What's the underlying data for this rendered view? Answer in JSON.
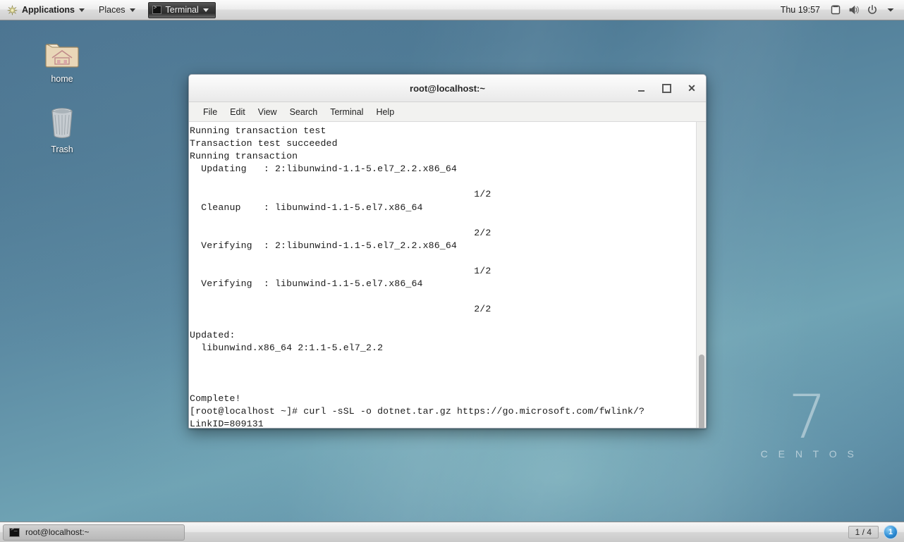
{
  "top_panel": {
    "applications_label": "Applications",
    "places_label": "Places",
    "window_item_label": "Terminal",
    "clock": "Thu 19:57",
    "tray": [
      {
        "name": "display-icon",
        "label": "display"
      },
      {
        "name": "volume-icon",
        "label": "volume"
      },
      {
        "name": "power-icon",
        "label": "power"
      }
    ]
  },
  "desktop_icons": [
    {
      "name": "home",
      "label": "home"
    },
    {
      "name": "trash",
      "label": "Trash"
    }
  ],
  "watermark": {
    "version": "7",
    "name": "C E N T O S"
  },
  "terminal": {
    "title": "root@localhost:~",
    "menu": [
      "File",
      "Edit",
      "View",
      "Search",
      "Terminal",
      "Help"
    ],
    "window_buttons": {
      "minimize": "_",
      "maximize": "□",
      "close": "✕"
    },
    "lines": [
      "Running transaction test",
      "Transaction test succeeded",
      "Running transaction",
      "  Updating   : 2:libunwind-1.1-5.el7_2.2.x86_64",
      "",
      "                                                  1/2",
      "  Cleanup    : libunwind-1.1-5.el7.x86_64",
      "",
      "                                                  2/2",
      "  Verifying  : 2:libunwind-1.1-5.el7_2.2.x86_64",
      "",
      "                                                  1/2",
      "  Verifying  : libunwind-1.1-5.el7.x86_64",
      "",
      "                                                  2/2",
      "",
      "Updated:",
      "  libunwind.x86_64 2:1.1-5.el7_2.2",
      "",
      "",
      "",
      "Complete!",
      "[root@localhost ~]# curl -sSL -o dotnet.tar.gz https://go.microsoft.com/fwlink/?",
      "LinkID=809131"
    ]
  },
  "bottom_panel": {
    "task_label": "root@localhost:~",
    "workspace": "1 / 4",
    "notification_count": "1"
  },
  "colors": {
    "desktop_base": "#5d8ca4",
    "panel_bg": "#ededed",
    "terminal_bg": "#ffffff",
    "terminal_fg": "#1b1b1b",
    "accent_blue": "#2f8ed6"
  }
}
